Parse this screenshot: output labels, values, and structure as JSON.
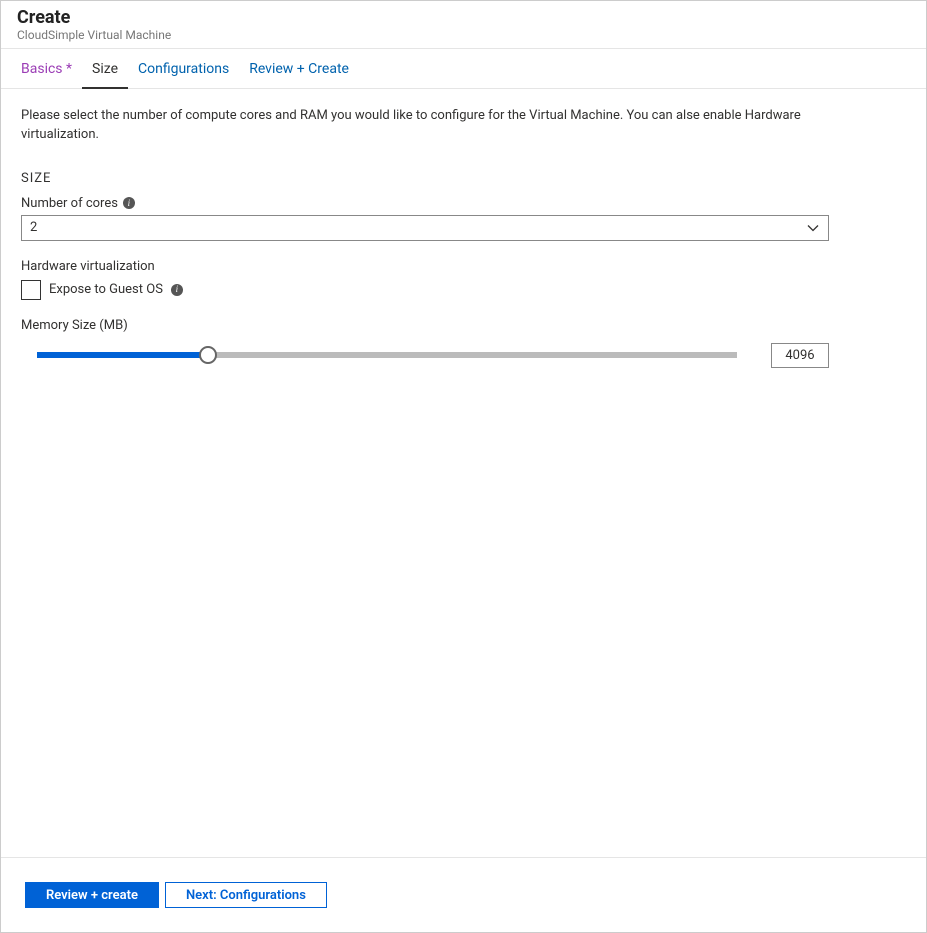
{
  "header": {
    "title": "Create",
    "subtitle": "CloudSimple Virtual Machine"
  },
  "tabs": [
    {
      "label": "Basics *",
      "state": "completed"
    },
    {
      "label": "Size",
      "state": "active"
    },
    {
      "label": "Configurations",
      "state": "default"
    },
    {
      "label": "Review + Create",
      "state": "default"
    }
  ],
  "intro": "Please select the number of compute cores and RAM you would like to configure for the Virtual Machine. You can alse enable Hardware virtualization.",
  "size_section": {
    "heading": "SIZE",
    "cores_label": "Number of cores",
    "cores_value": "2"
  },
  "hardware_virtualization": {
    "heading": "Hardware virtualization",
    "checkbox_label": "Expose to Guest OS",
    "checked": false
  },
  "memory": {
    "label": "Memory Size (MB)",
    "value": "4096"
  },
  "footer": {
    "primary": "Review + create",
    "secondary": "Next: Configurations"
  }
}
